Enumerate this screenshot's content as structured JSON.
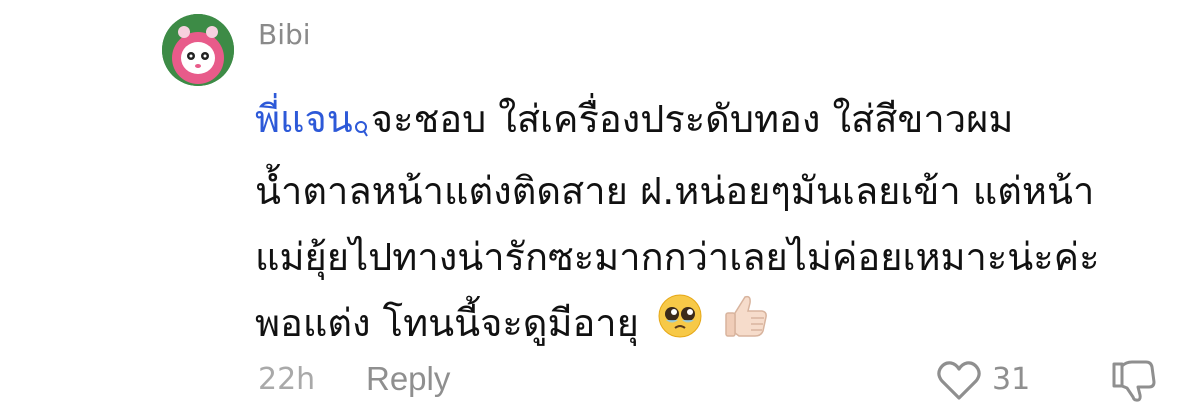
{
  "comment": {
    "username": "Bibi",
    "mention": "พี่แจน",
    "lines": [
      "จะชอบ ใส่เครื่องประดับทอง ใส่สีขาวผม",
      "น้ำตาลหน้าแต่งติดสาย ฝ.หน่อยๆมันเลยเข้า แต่หน้า",
      "แม่ยุ้ยไปทางน่ารักซะมากกว่าเลยไม่ค่อยเหมาะน่ะค่ะ",
      "พอแต่ง โทนนี้จะดูมีอายุ"
    ],
    "emojis": [
      "pleading-face-emoji",
      "thumbs-up-emoji"
    ]
  },
  "footer": {
    "time": "22h",
    "reply_label": "Reply",
    "like_count": "31"
  },
  "icons": {
    "mention": "search-icon",
    "like": "heart-icon",
    "dislike": "thumbs-down-icon"
  },
  "colors": {
    "mention": "#2d59d8",
    "username": "#8a8a8a",
    "meta": "#8f8f8f"
  }
}
